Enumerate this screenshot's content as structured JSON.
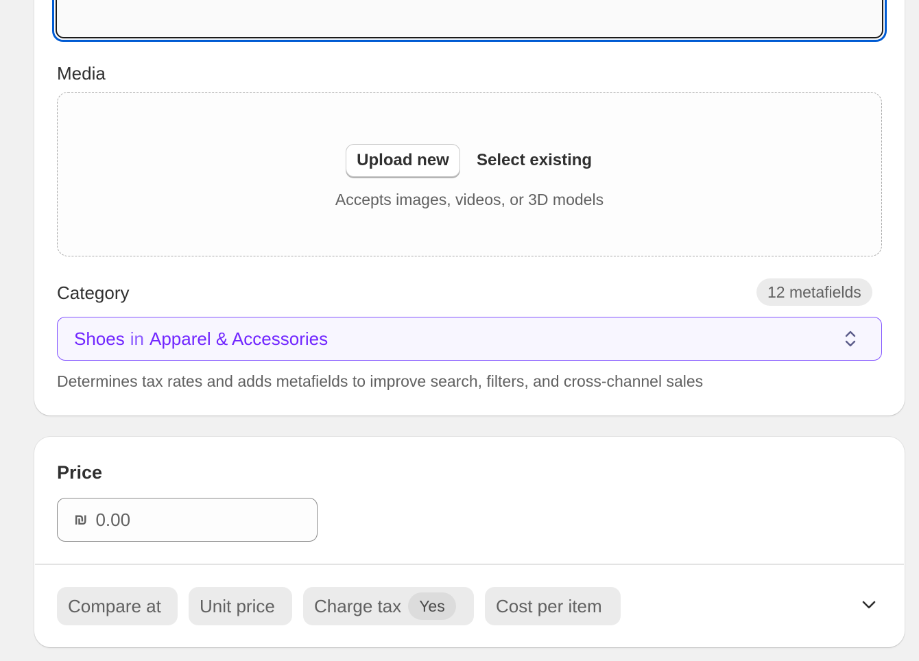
{
  "media": {
    "label": "Media",
    "upload_button": "Upload new",
    "select_button": "Select existing",
    "hint": "Accepts images, videos, or 3D models"
  },
  "category": {
    "label": "Category",
    "metafields_badge": "12 metafields",
    "selected_name": "Shoes",
    "connector": "in",
    "selected_parent": "Apparel & Accessories",
    "help": "Determines tax rates and adds metafields to improve search, filters, and cross-channel sales"
  },
  "price": {
    "heading": "Price",
    "currency_symbol": "₪",
    "placeholder": "0.00"
  },
  "pricing_options": {
    "compare_at": "Compare at",
    "unit_price": "Unit price",
    "charge_tax": "Charge tax",
    "charge_tax_value": "Yes",
    "cost_per_item": "Cost per item"
  },
  "colors": {
    "focus_ring": "#005bd3",
    "category_accent": "#7126ff"
  },
  "icons": {
    "category_selector": "chevron-up-down-icon",
    "expand": "chevron-down-icon"
  }
}
